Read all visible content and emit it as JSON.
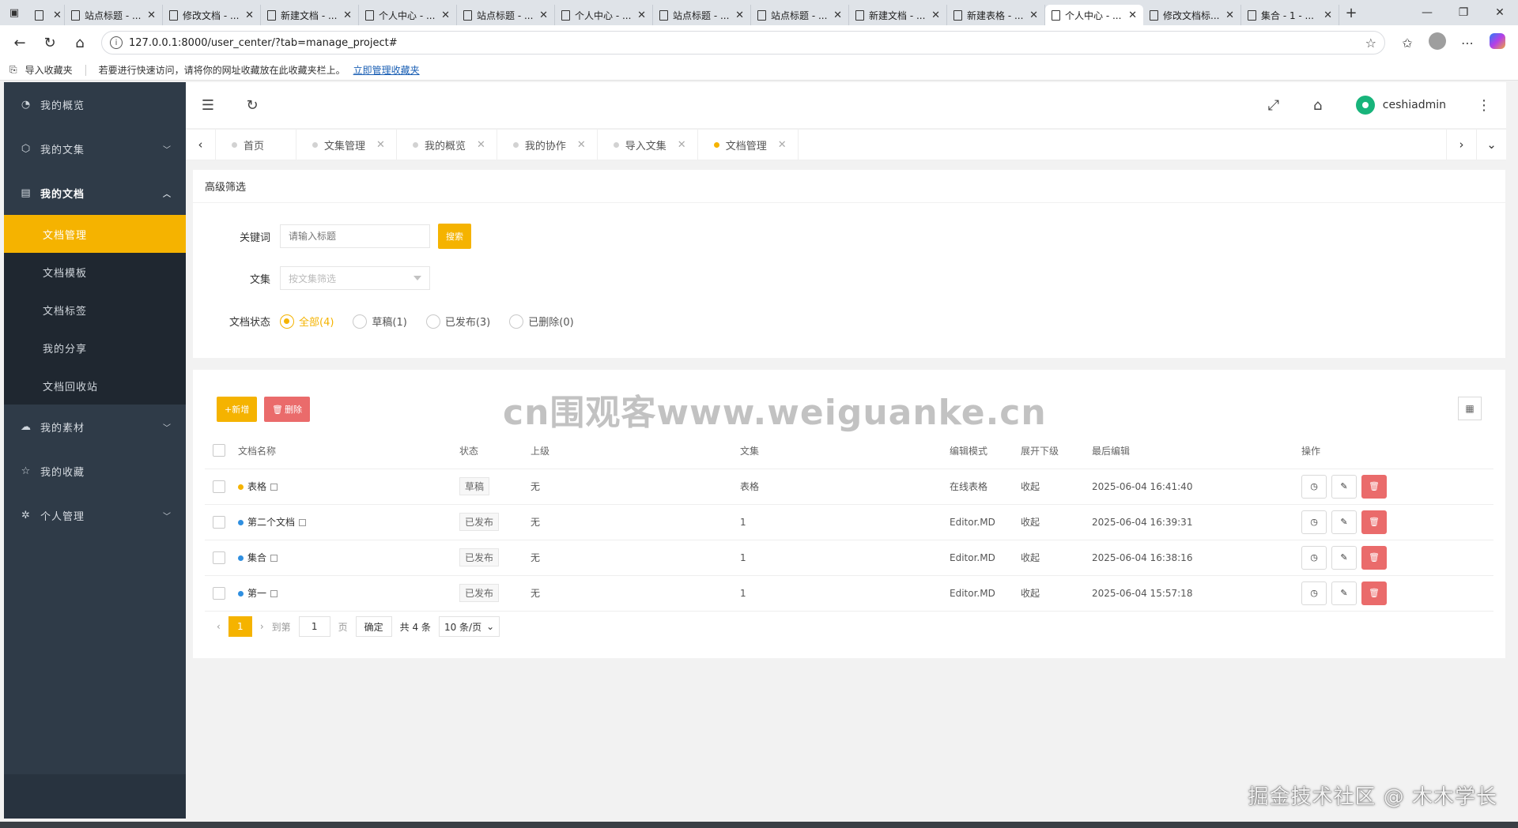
{
  "browser": {
    "tabs": [
      {
        "title": "",
        "active": false
      },
      {
        "title": "站点标题 - ...",
        "active": false
      },
      {
        "title": "修改文档 - ...",
        "active": false
      },
      {
        "title": "新建文档 - ...",
        "active": false
      },
      {
        "title": "个人中心 - ...",
        "active": false
      },
      {
        "title": "站点标题 - ...",
        "active": false
      },
      {
        "title": "个人中心 - ...",
        "active": false
      },
      {
        "title": "站点标题 - ...",
        "active": false
      },
      {
        "title": "站点标题 - ...",
        "active": false
      },
      {
        "title": "新建文档 - ...",
        "active": false
      },
      {
        "title": "新建表格 - ...",
        "active": false
      },
      {
        "title": "个人中心 - ...",
        "active": true
      },
      {
        "title": "修改文档标...",
        "active": false
      },
      {
        "title": "集合 - 1 - ...",
        "active": false
      }
    ],
    "url": "127.0.0.1:8000/user_center/?tab=manage_project#",
    "favbar": {
      "import_label": "导入收藏夹",
      "hint": "若要进行快速访问，请将你的网址收藏放在此收藏夹栏上。",
      "manage_link": "立即管理收藏夹"
    }
  },
  "sidebar": {
    "items": [
      {
        "label": "我的概览",
        "icon": "dashboard-icon"
      },
      {
        "label": "我的文集",
        "icon": "cube-icon"
      },
      {
        "label": "我的文档",
        "icon": "document-icon"
      },
      {
        "label": "我的素材",
        "icon": "cloud-icon"
      },
      {
        "label": "我的收藏",
        "icon": "star-icon"
      },
      {
        "label": "个人管理",
        "icon": "gear-icon"
      }
    ],
    "subitems": [
      "文档管理",
      "文档模板",
      "文档标签",
      "我的分享",
      "文档回收站"
    ]
  },
  "topbar": {
    "username": "ceshiadmin"
  },
  "page_tabs": [
    {
      "label": "首页",
      "closable": false
    },
    {
      "label": "文集管理",
      "closable": true
    },
    {
      "label": "我的概览",
      "closable": true
    },
    {
      "label": "我的协作",
      "closable": true
    },
    {
      "label": "导入文集",
      "closable": true
    },
    {
      "label": "文档管理",
      "closable": true,
      "active": true
    }
  ],
  "filter": {
    "title": "高级筛选",
    "keyword_label": "关键词",
    "keyword_placeholder": "请输入标题",
    "search_button": "搜索",
    "collection_label": "文集",
    "collection_placeholder": "按文集筛选",
    "status_label": "文档状态",
    "status_options": [
      "全部(4)",
      "草稿(1)",
      "已发布(3)",
      "已删除(0)"
    ]
  },
  "toolbar": {
    "add_label": "+新增",
    "delete_label": "删除"
  },
  "watermark": "cn围观客www.weiguanke.cn",
  "table": {
    "headers": [
      "文档名称",
      "状态",
      "上级",
      "文集",
      "编辑模式",
      "展开下级",
      "最后编辑",
      "操作"
    ],
    "rows": [
      {
        "name": "表格",
        "dot": "#f5b300",
        "status": "草稿",
        "parent": "无",
        "collection": "表格",
        "mode": "在线表格",
        "expand": "收起",
        "edited": "2025-06-04 16:41:40"
      },
      {
        "name": "第二个文档",
        "dot": "#2f8fe0",
        "status": "已发布",
        "parent": "无",
        "collection": "1",
        "mode": "Editor.MD",
        "expand": "收起",
        "edited": "2025-06-04 16:39:31"
      },
      {
        "name": "集合",
        "dot": "#2f8fe0",
        "status": "已发布",
        "parent": "无",
        "collection": "1",
        "mode": "Editor.MD",
        "expand": "收起",
        "edited": "2025-06-04 16:38:16"
      },
      {
        "name": "第一",
        "dot": "#2f8fe0",
        "status": "已发布",
        "parent": "无",
        "collection": "1",
        "mode": "Editor.MD",
        "expand": "收起",
        "edited": "2025-06-04 15:57:18"
      }
    ]
  },
  "pager": {
    "current": "1",
    "goto_label": "到第",
    "goto_value": "1",
    "page_label": "页",
    "confirm_label": "确定",
    "total": "共 4 条",
    "page_size": "10 条/页"
  },
  "footer_watermark": "掘金技术社区 @ 木木学长",
  "colors": {
    "accent": "#f5b300",
    "danger": "#ea6b6b",
    "sidebar": "#2f3b48"
  }
}
